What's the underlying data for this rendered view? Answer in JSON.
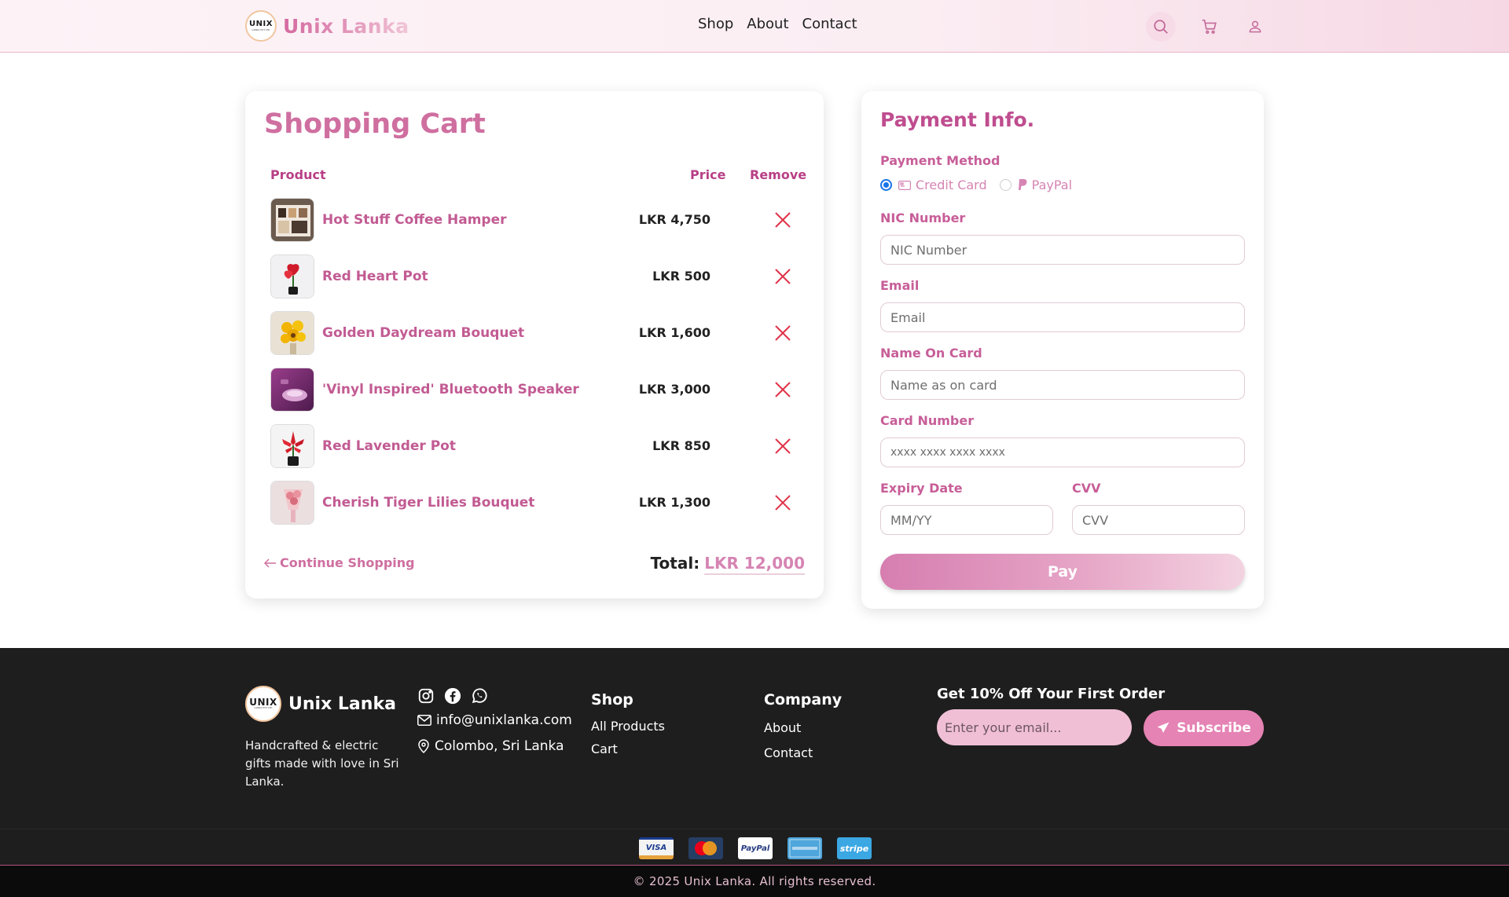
{
  "brand": {
    "name": "Unix Lanka",
    "logo_text": "UNIX",
    "logo_subtext": "LANKA PVT LTD"
  },
  "nav": {
    "items": [
      "Shop",
      "About",
      "Contact"
    ]
  },
  "header_icons": {
    "search": "search-icon",
    "cart": "cart-icon",
    "user": "user-icon"
  },
  "cart": {
    "title": "Shopping Cart",
    "columns": {
      "product": "Product",
      "price": "Price",
      "remove": "Remove"
    },
    "items": [
      {
        "name": "Hot Stuff Coffee Hamper",
        "price": "LKR 4,750"
      },
      {
        "name": "Red Heart Pot",
        "price": "LKR 500"
      },
      {
        "name": "Golden Daydream Bouquet",
        "price": "LKR 1,600"
      },
      {
        "name": "'Vinyl Inspired' Bluetooth Speaker",
        "price": "LKR 3,000"
      },
      {
        "name": "Red Lavender Pot",
        "price": "LKR 850"
      },
      {
        "name": "Cherish Tiger Lilies Bouquet",
        "price": "LKR 1,300"
      }
    ],
    "continue_label": "Continue Shopping",
    "total_label": "Total:",
    "total_value": "LKR 12,000"
  },
  "payment": {
    "title": "Payment Info.",
    "method_label": "Payment Method",
    "methods": [
      "Credit Card",
      "PayPal"
    ],
    "selected_method": "Credit Card",
    "nic_label": "NIC Number",
    "nic_placeholder": "NIC Number",
    "email_label": "Email",
    "email_placeholder": "Email",
    "name_label": "Name On Card",
    "name_placeholder": "Name as on card",
    "card_label": "Card Number",
    "card_placeholder": "xxxx xxxx xxxx xxxx",
    "expiry_label": "Expiry Date",
    "expiry_placeholder": "MM/YY",
    "cvv_label": "CVV",
    "cvv_placeholder": "CVV",
    "pay_label": "Pay"
  },
  "footer": {
    "description": "Handcrafted & electric gifts made with love in Sri Lanka.",
    "email": "info@unixlanka.com",
    "location": "Colombo, Sri Lanka",
    "shop_title": "Shop",
    "shop_links": [
      "All Products",
      "Cart"
    ],
    "company_title": "Company",
    "company_links": [
      "About",
      "Contact"
    ],
    "newsletter_title": "Get 10% Off Your First Order",
    "newsletter_placeholder": "Enter your email...",
    "subscribe_label": "Subscribe",
    "payment_methods": [
      "VISA",
      "MasterCard",
      "PayPal",
      "AMERICAN EXPRESS",
      "stripe"
    ],
    "copyright": "© 2025 Unix Lanka. All rights reserved."
  },
  "colors": {
    "accent": "#cf6fa0",
    "accent_dark": "#b83f86",
    "footer_bg": "#1f1e1e",
    "remove": "#e0344a"
  }
}
